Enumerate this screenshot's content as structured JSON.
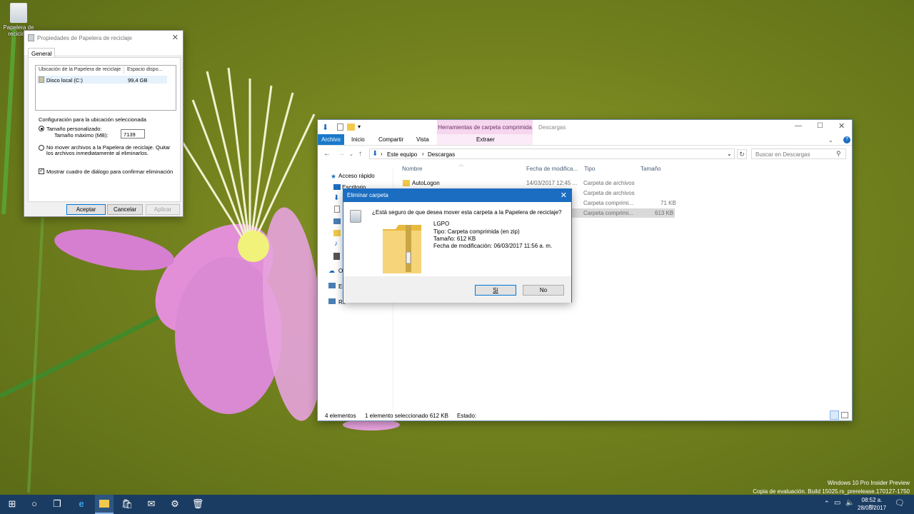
{
  "desktop": {
    "recycle_bin_label": "Papelera de reciclaje",
    "watermark_line1": "Windows 10 Pro Insider Preview",
    "watermark_line2": "Copia de evaluación. Build 15025.rs_prerelease.170127-1750"
  },
  "props": {
    "title": "Propiedades de Papelera de reciclaje",
    "tab": "General",
    "col_location": "Ubicación de la Papelera de reciclaje",
    "col_space": "Espacio dispo...",
    "drive_name": "Disco local (C:)",
    "drive_space": "99,4 GB",
    "group_label": "Configuración para la ubicación seleccionada",
    "custom_size": "Tamaño personalizado:",
    "max_size": "Tamaño máximo (MB):",
    "max_size_value": "7139",
    "no_move_line1": "No mover archivos a la Papelera de reciclaje. Quitar",
    "no_move_line2": "los archivos inmediatamente al eliminarlos.",
    "confirm_dialog": "Mostrar cuadro de diálogo para confirmar eliminación",
    "btn_ok": "Aceptar",
    "btn_cancel": "Cancelar",
    "btn_apply": "Aplicar"
  },
  "explorer": {
    "context_header": "Herramientas de carpeta comprimida",
    "window_title": "Descargas",
    "tabs": [
      "Archivo",
      "Inicio",
      "Compartir",
      "Vista"
    ],
    "context_tab": "Extraer",
    "breadcrumb": [
      "Este equipo",
      "Descargas"
    ],
    "search_placeholder": "Buscar en Descargas",
    "nav_quick": "Acceso rápido",
    "nav_desktop": "Escritorio",
    "nav_onedrive": "O",
    "nav_pc": "Es",
    "nav_network": "Re",
    "columns": {
      "name": "Nombre",
      "date": "Fecha de modifica...",
      "type": "Tipo",
      "size": "Tamaño"
    },
    "rows": [
      {
        "name": "AutoLogon",
        "date": "14/03/2017 12:45 ...",
        "type": "Carpeta de archivos",
        "size": ""
      },
      {
        "name": "",
        "date": "",
        "type": "Carpeta de archivos",
        "size": ""
      },
      {
        "name": "",
        "date": "",
        "type": "Carpeta comprimi...",
        "size": "71 KB"
      },
      {
        "name": "",
        "date": "",
        "type": "Carpeta comprimi...",
        "size": "613 KB"
      }
    ],
    "status_items": "4 elementos",
    "status_selected": "1 elemento seleccionado  612 KB",
    "status_state": "Estado:"
  },
  "delete_dialog": {
    "title": "Eliminar carpeta",
    "question": "¿Está seguro de que desea mover esta carpeta a la Papelera de reciclaje?",
    "file_name": "LGPO",
    "file_type": "Tipo: Carpeta comprimida (en zip)",
    "file_size": "Tamaño: 612 KB",
    "file_date": "Fecha de modificación: 06/03/2017 11:56 a. m.",
    "btn_yes": "Sí",
    "btn_no": "No"
  },
  "taskbar": {
    "time": "08:52 a. m.",
    "date": "28/03/2017"
  }
}
